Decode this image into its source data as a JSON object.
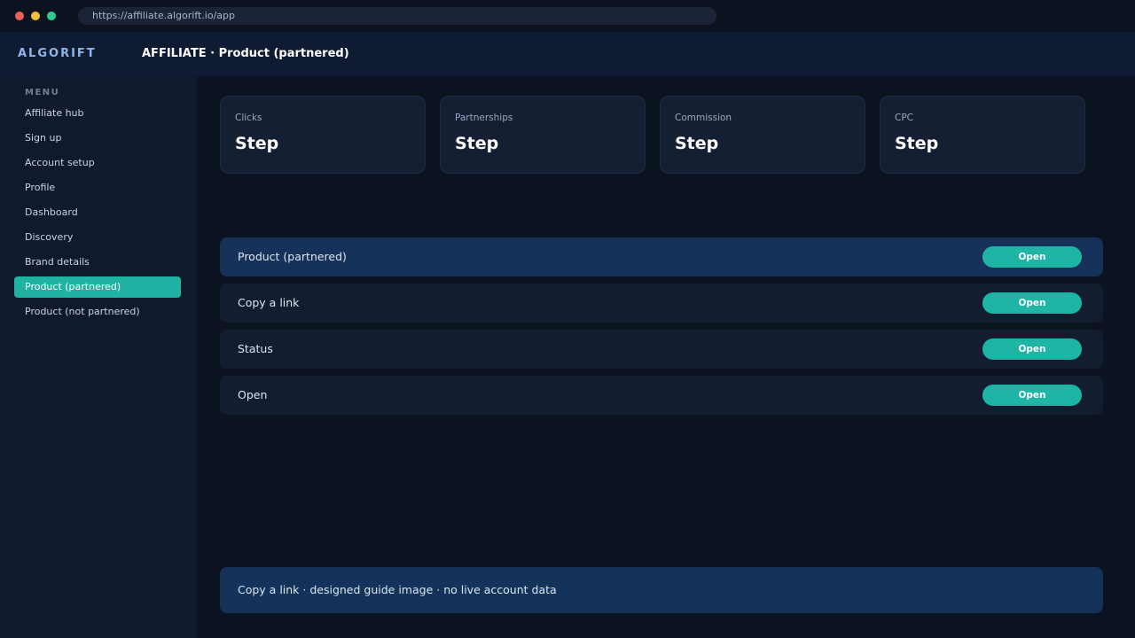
{
  "browser": {
    "url": "https://affiliate.algorift.io/app"
  },
  "header": {
    "brand": "ALGORIFT",
    "title": "AFFILIATE · Product (partnered)"
  },
  "sidebar": {
    "menu_label": "MENU",
    "items": [
      {
        "label": "Affiliate hub"
      },
      {
        "label": "Sign up"
      },
      {
        "label": "Account setup"
      },
      {
        "label": "Profile"
      },
      {
        "label": "Dashboard"
      },
      {
        "label": "Discovery"
      },
      {
        "label": "Brand details"
      },
      {
        "label": "Product (partnered)",
        "active": true
      },
      {
        "label": "Product (not partnered)"
      }
    ]
  },
  "kpis": [
    {
      "label": "Clicks",
      "value": "Step"
    },
    {
      "label": "Partnerships",
      "value": "Step"
    },
    {
      "label": "Commission",
      "value": "Step"
    },
    {
      "label": "CPC",
      "value": "Step"
    }
  ],
  "rows": [
    {
      "label": "Product (partnered)",
      "button": "Open",
      "active": true
    },
    {
      "label": "Copy a link",
      "button": "Open"
    },
    {
      "label": "Status",
      "button": "Open"
    },
    {
      "label": "Open",
      "button": "Open"
    }
  ],
  "footer": {
    "text": "Copy a link · designed guide image · no live account data"
  },
  "colors": {
    "accent": "#1fb5a4",
    "background": "#0b1220",
    "header": "#0e1b33",
    "active_row": "#16325b"
  }
}
